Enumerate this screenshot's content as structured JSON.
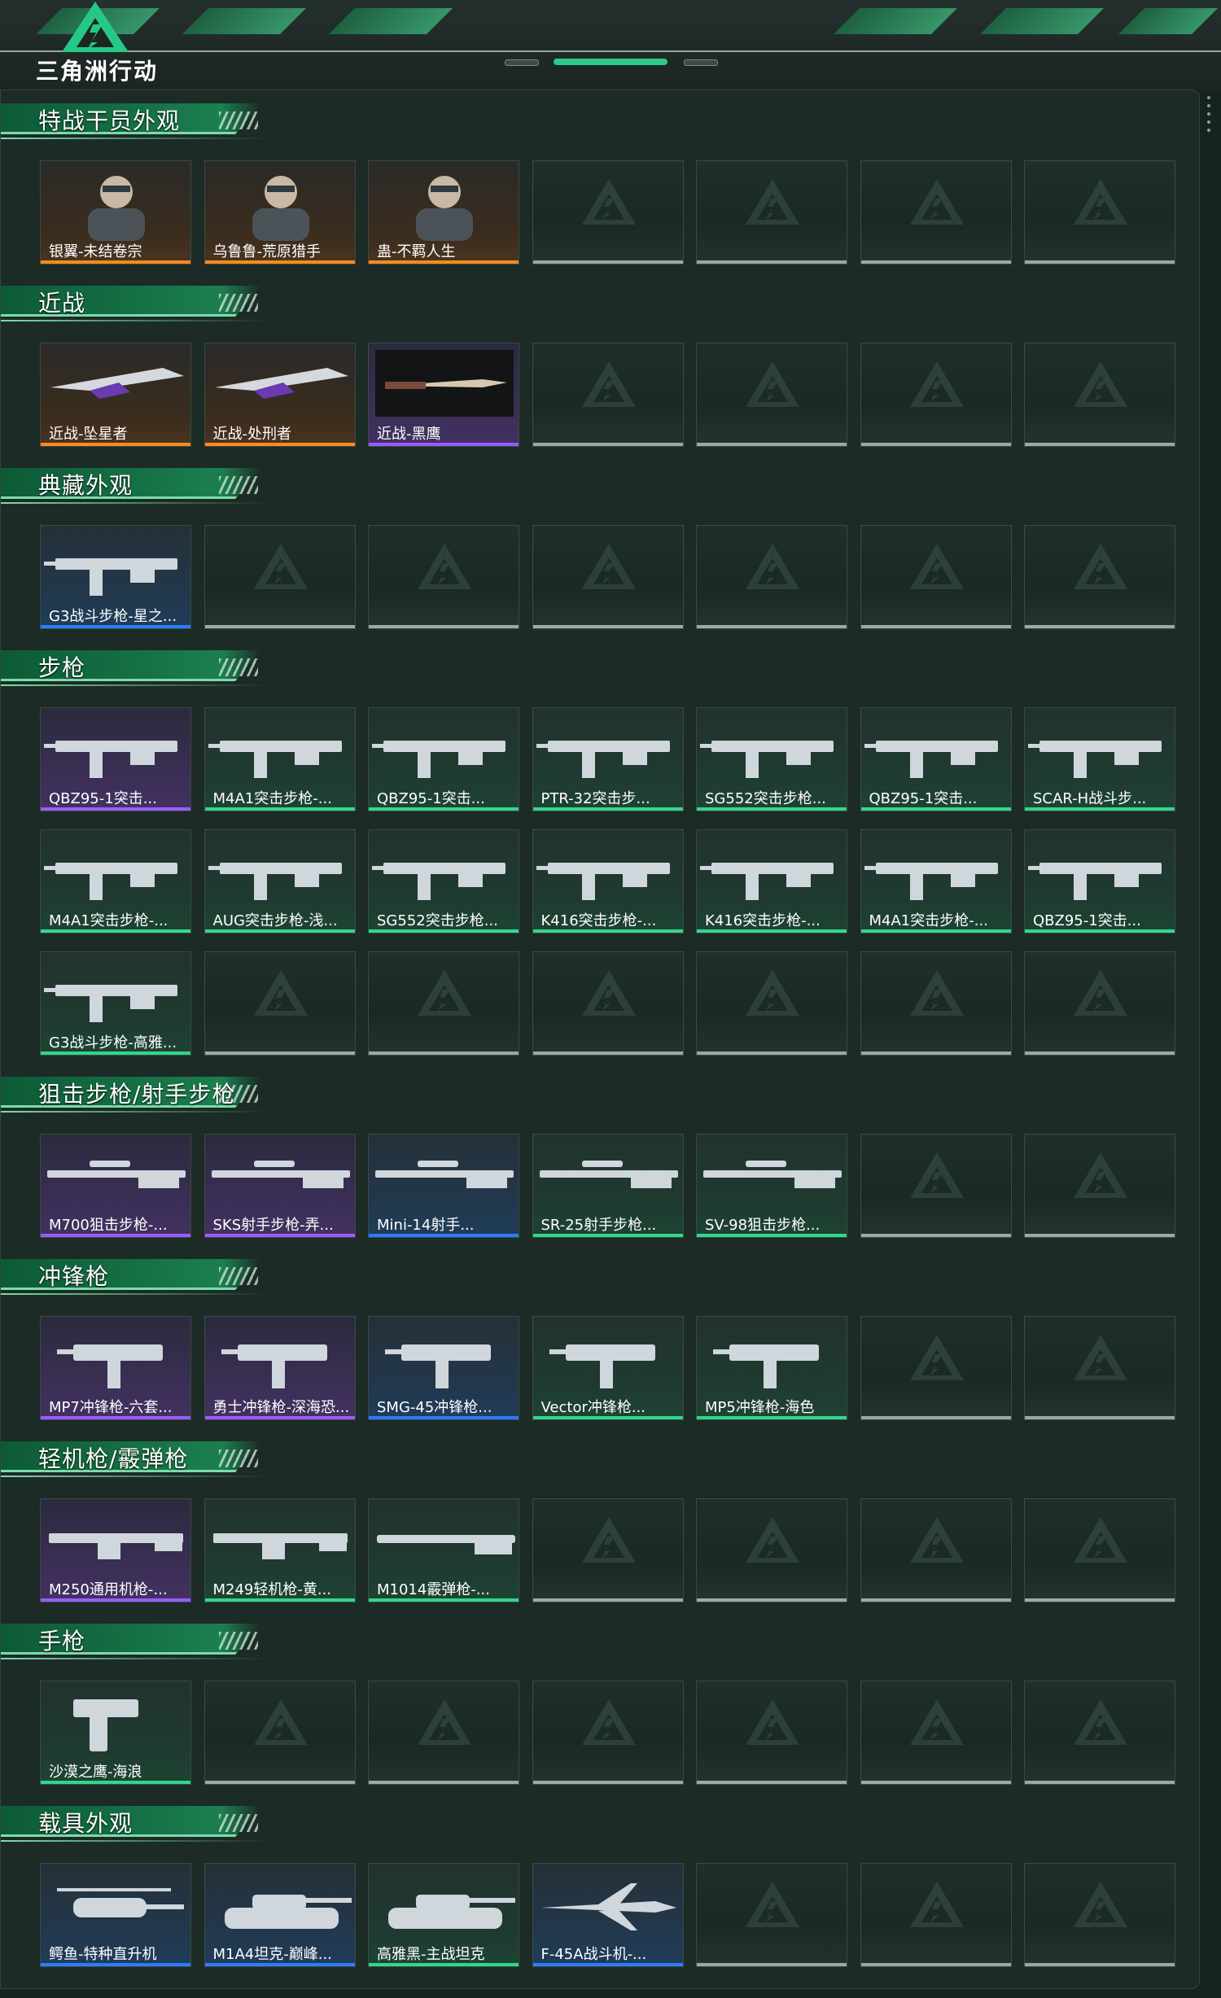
{
  "logo": {
    "text": "三角洲行动"
  },
  "colors": {
    "accent": "#2fc98a",
    "orange": "#ff8a1d",
    "purple": "#9a5cff",
    "blue": "#2d7bff",
    "green": "#30d78c",
    "empty": "#9ea7a3"
  },
  "sections": [
    {
      "title": "特战干员外观",
      "rows": 1,
      "items": [
        {
          "name": "银翼-未结卷宗",
          "rarity": "orange",
          "icon": "operator-portrait-icon"
        },
        {
          "name": "乌鲁鲁-荒原猎手",
          "rarity": "orange",
          "icon": "operator-portrait-icon"
        },
        {
          "name": "蛊-不羁人生",
          "rarity": "orange",
          "icon": "operator-portrait-icon"
        }
      ]
    },
    {
      "title": "近战",
      "rows": 1,
      "items": [
        {
          "name": "近战-坠星者",
          "rarity": "orange",
          "icon": "melee-blade-icon"
        },
        {
          "name": "近战-处刑者",
          "rarity": "orange",
          "icon": "melee-blade-icon"
        },
        {
          "name": "近战-黑鹰",
          "rarity": "purple",
          "icon": "melee-knife-icon"
        }
      ]
    },
    {
      "title": "典藏外观",
      "rows": 1,
      "items": [
        {
          "name": "G3战斗步枪-星之...",
          "rarity": "blue",
          "icon": "rifle-icon"
        }
      ]
    },
    {
      "title": "步枪",
      "rows": 3,
      "items": [
        {
          "name": "QBZ95-1突击...",
          "rarity": "purple",
          "icon": "rifle-icon"
        },
        {
          "name": "M4A1突击步枪-...",
          "rarity": "green",
          "icon": "rifle-icon"
        },
        {
          "name": "QBZ95-1突击...",
          "rarity": "green",
          "icon": "rifle-icon"
        },
        {
          "name": "PTR-32突击步...",
          "rarity": "green",
          "icon": "rifle-icon"
        },
        {
          "name": "SG552突击步枪...",
          "rarity": "green",
          "icon": "rifle-icon"
        },
        {
          "name": "QBZ95-1突击...",
          "rarity": "green",
          "icon": "rifle-icon"
        },
        {
          "name": "SCAR-H战斗步...",
          "rarity": "green",
          "icon": "rifle-icon"
        },
        {
          "name": "M4A1突击步枪-...",
          "rarity": "green",
          "icon": "rifle-icon"
        },
        {
          "name": "AUG突击步枪-浅...",
          "rarity": "green",
          "icon": "rifle-icon"
        },
        {
          "name": "SG552突击步枪...",
          "rarity": "green",
          "icon": "rifle-icon"
        },
        {
          "name": "K416突击步枪-...",
          "rarity": "green",
          "icon": "rifle-icon"
        },
        {
          "name": "K416突击步枪-...",
          "rarity": "green",
          "icon": "rifle-icon"
        },
        {
          "name": "M4A1突击步枪-...",
          "rarity": "green",
          "icon": "rifle-icon"
        },
        {
          "name": "QBZ95-1突击...",
          "rarity": "green",
          "icon": "rifle-icon"
        },
        {
          "name": "G3战斗步枪-高雅...",
          "rarity": "green",
          "icon": "rifle-icon"
        }
      ]
    },
    {
      "title": "狙击步枪/射手步枪",
      "rows": 1,
      "items": [
        {
          "name": "M700狙击步枪-...",
          "rarity": "purple",
          "icon": "sniper-icon"
        },
        {
          "name": "SKS射手步枪-弄...",
          "rarity": "purple",
          "icon": "sniper-icon"
        },
        {
          "name": "Mini-14射手...",
          "rarity": "blue",
          "icon": "sniper-icon"
        },
        {
          "name": "SR-25射手步枪...",
          "rarity": "green",
          "icon": "sniper-icon"
        },
        {
          "name": "SV-98狙击步枪...",
          "rarity": "green",
          "icon": "sniper-icon"
        }
      ]
    },
    {
      "title": "冲锋枪",
      "rows": 1,
      "items": [
        {
          "name": "MP7冲锋枪-六套...",
          "rarity": "purple",
          "icon": "smg-icon"
        },
        {
          "name": "勇士冲锋枪-深海恐...",
          "rarity": "purple",
          "icon": "smg-icon"
        },
        {
          "name": "SMG-45冲锋枪...",
          "rarity": "blue",
          "icon": "smg-icon"
        },
        {
          "name": "Vector冲锋枪...",
          "rarity": "green",
          "icon": "smg-icon"
        },
        {
          "name": "MP5冲锋枪-海色",
          "rarity": "green",
          "icon": "smg-icon"
        }
      ]
    },
    {
      "title": "轻机枪/霰弹枪",
      "rows": 1,
      "items": [
        {
          "name": "M250通用机枪-...",
          "rarity": "purple",
          "icon": "lmg-icon"
        },
        {
          "name": "M249轻机枪-黄...",
          "rarity": "green",
          "icon": "lmg-icon"
        },
        {
          "name": "M1014霰弹枪-...",
          "rarity": "green",
          "icon": "shotgun-icon"
        }
      ]
    },
    {
      "title": "手枪",
      "rows": 1,
      "items": [
        {
          "name": "沙漠之鹰-海浪",
          "rarity": "green",
          "icon": "pistol-icon"
        }
      ]
    },
    {
      "title": "载具外观",
      "rows": 1,
      "items": [
        {
          "name": "鳄鱼-特种直升机",
          "rarity": "blue",
          "icon": "helicopter-icon"
        },
        {
          "name": "M1A4坦克-巅峰...",
          "rarity": "blue",
          "icon": "tank-icon"
        },
        {
          "name": "高雅黑-主战坦克",
          "rarity": "green",
          "icon": "tank-icon"
        },
        {
          "name": "F-45A战斗机-...",
          "rarity": "blue",
          "icon": "jet-icon"
        }
      ]
    }
  ]
}
